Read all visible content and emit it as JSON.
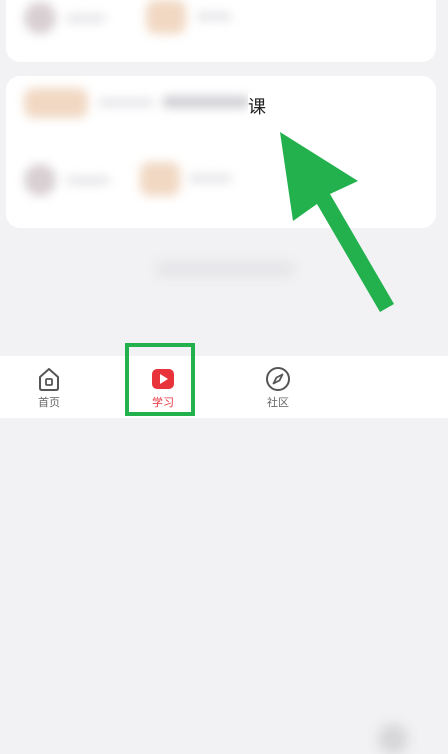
{
  "partial_text": "课",
  "bottom_nav": {
    "home_label": "首页",
    "study_label": "学习",
    "community_label": "社区"
  },
  "colors": {
    "accent": "#e8333b",
    "highlight": "#23b14d",
    "arrow": "#23b14d"
  },
  "icons": {
    "home": "home-icon",
    "study": "play-icon",
    "community": "compass-icon"
  }
}
